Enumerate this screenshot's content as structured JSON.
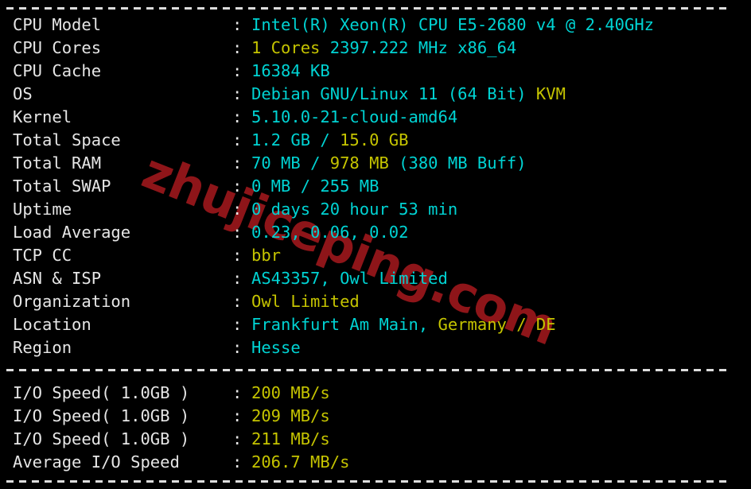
{
  "terminal": {
    "background_color": "#000000",
    "label_color": "#e6e6e6",
    "value_cyan": "#00d3d3",
    "value_yellow": "#c5c400",
    "separator": ":"
  },
  "watermark": {
    "text": "zhujiceping.com",
    "color": "#8e1519"
  },
  "system_info": {
    "rows": [
      {
        "label": "CPU Model",
        "value": "Intel(R) Xeon(R) CPU E5-2680 v4 @ 2.40GHz"
      },
      {
        "label": "CPU Cores",
        "value": "1 Cores 2397.222 MHz x86_64"
      },
      {
        "label": "CPU Cache",
        "value": "16384 KB"
      },
      {
        "label": "OS",
        "value": "Debian GNU/Linux 11 (64 Bit) KVM"
      },
      {
        "label": "Kernel",
        "value": "5.10.0-21-cloud-amd64"
      },
      {
        "label": "Total Space",
        "value": "1.2 GB / 15.0 GB"
      },
      {
        "label": "Total RAM",
        "value": "70 MB / 978 MB (380 MB Buff)"
      },
      {
        "label": "Total SWAP",
        "value": "0 MB / 255 MB"
      },
      {
        "label": "Uptime",
        "value": "0 days 20 hour 53 min"
      },
      {
        "label": "Load Average",
        "value": "0.23, 0.06, 0.02"
      },
      {
        "label": "TCP CC",
        "value": "bbr"
      },
      {
        "label": "ASN & ISP",
        "value": "AS43357, Owl Limited"
      },
      {
        "label": "Organization",
        "value": "Owl Limited"
      },
      {
        "label": "Location",
        "value": "Frankfurt Am Main, Germany / DE"
      },
      {
        "label": "Region",
        "value": "Hesse"
      }
    ],
    "segments": {
      "cpu_model": [
        {
          "t": "Intel(R) Xeon(R) CPU E5-2680 v4 @ 2.40GHz",
          "c": "cy"
        }
      ],
      "cpu_cores": [
        {
          "t": "1 Cores ",
          "c": "ye"
        },
        {
          "t": "2397.222 MHz x86_64",
          "c": "cy"
        }
      ],
      "cpu_cache": [
        {
          "t": "16384 KB",
          "c": "cy"
        }
      ],
      "os": [
        {
          "t": "Debian GNU/Linux 11 (64 Bit) ",
          "c": "cy"
        },
        {
          "t": "KVM",
          "c": "ye"
        }
      ],
      "kernel": [
        {
          "t": "5.10.0-21-cloud-amd64",
          "c": "cy"
        }
      ],
      "total_space": [
        {
          "t": "1.2 GB ",
          "c": "cy"
        },
        {
          "t": "/ ",
          "c": "cy"
        },
        {
          "t": "15.0 GB",
          "c": "ye"
        }
      ],
      "total_ram": [
        {
          "t": "70 MB ",
          "c": "cy"
        },
        {
          "t": "/ ",
          "c": "cy"
        },
        {
          "t": "978 MB ",
          "c": "ye"
        },
        {
          "t": "(380 MB Buff)",
          "c": "cy"
        }
      ],
      "total_swap": [
        {
          "t": "0 MB / 255 MB",
          "c": "cy"
        }
      ],
      "uptime": [
        {
          "t": "0 days 20 hour 53 min",
          "c": "cy"
        }
      ],
      "load_average": [
        {
          "t": "0.23, 0.06, 0.02",
          "c": "cy"
        }
      ],
      "tcp_cc": [
        {
          "t": "bbr",
          "c": "ye"
        }
      ],
      "asn_isp": [
        {
          "t": "AS43357, Owl Limited",
          "c": "cy"
        }
      ],
      "organization": [
        {
          "t": "Owl Limited",
          "c": "ye"
        }
      ],
      "location": [
        {
          "t": "Frankfurt Am Main, ",
          "c": "cy"
        },
        {
          "t": "Germany / DE",
          "c": "ye"
        }
      ],
      "region": [
        {
          "t": "Hesse",
          "c": "cy"
        }
      ]
    }
  },
  "io_test": {
    "rows": [
      {
        "label": "I/O Speed( 1.0GB )",
        "value": "200 MB/s"
      },
      {
        "label": "I/O Speed( 1.0GB )",
        "value": "209 MB/s"
      },
      {
        "label": "I/O Speed( 1.0GB )",
        "value": "211 MB/s"
      },
      {
        "label": "Average I/O Speed",
        "value": "206.7 MB/s"
      }
    ],
    "segments": {
      "io_1": [
        {
          "t": "200 MB/s",
          "c": "ye"
        }
      ],
      "io_2": [
        {
          "t": "209 MB/s",
          "c": "ye"
        }
      ],
      "io_3": [
        {
          "t": "211 MB/s",
          "c": "ye"
        }
      ],
      "io_avg": [
        {
          "t": "206.7 MB/s",
          "c": "ye"
        }
      ]
    }
  }
}
